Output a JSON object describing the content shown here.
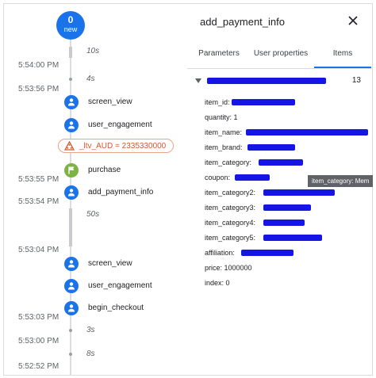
{
  "counter": {
    "count": "0",
    "label": "new"
  },
  "gaps": {
    "g1": "10s",
    "g2": "4s",
    "g3": "50s",
    "g4": "3s",
    "g5": "8s"
  },
  "timestamps": {
    "t1": "5:54:00 PM",
    "t2": "5:53:56 PM",
    "t3": "5:53:55 PM",
    "t4": "5:53:54 PM",
    "t5": "5:53:04 PM",
    "t6": "5:53:03 PM",
    "t7": "5:53:00 PM",
    "t8": "5:52:52 PM"
  },
  "events": {
    "e1": "screen_view",
    "e2": "user_engagement",
    "e3": "purchase",
    "e4": "add_payment_info",
    "e5": "screen_view",
    "e6": "user_engagement",
    "e7": "begin_checkout"
  },
  "ltv": {
    "label": "_ltv_AUD = 2335330000"
  },
  "panel": {
    "title": "add_payment_info",
    "tabs": [
      "Parameters",
      "User properties",
      "Items"
    ],
    "item_count": "13",
    "params": {
      "item_id": "item_id:",
      "quantity": "quantity: 1",
      "item_name": "item_name:",
      "item_brand": "item_brand:",
      "item_category": "item_category:",
      "coupon": "coupon:",
      "item_category2": "item_category2:",
      "item_category3": "item_category3:",
      "item_category4": "item_category4:",
      "item_category5": "item_category5:",
      "affiliation": "affiliation:",
      "price": "price: 1000000",
      "index": "index: 0"
    }
  },
  "tooltip": {
    "text": "item_category: Mem"
  },
  "colors": {
    "accent": "#1a73e8",
    "purchase": "#7cb342",
    "ltv": "#d35a2b",
    "redaction": "#1515e6"
  }
}
